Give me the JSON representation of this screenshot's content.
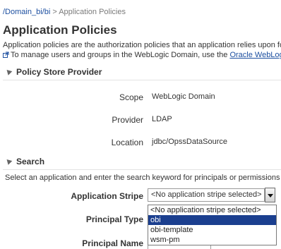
{
  "breadcrumb": {
    "link": "/Domain_bi/bi",
    "separator": ">",
    "current": "Application Policies"
  },
  "page": {
    "title": "Application Policies",
    "description": "Application policies are the authorization policies that an application relies upon for",
    "manage_text": "To manage users and groups in the WebLogic Domain, use the",
    "manage_link": "Oracle WebLogi",
    "manage_icon": "external-link-icon"
  },
  "policy_store": {
    "header": "Policy Store Provider",
    "scope_label": "Scope",
    "scope_value": "WebLogic Domain",
    "provider_label": "Provider",
    "provider_value": "LDAP",
    "location_label": "Location",
    "location_value": "jdbc/OpssDataSource"
  },
  "search": {
    "header": "Search",
    "description": "Select an application and enter the search keyword for principals or permissions",
    "stripe_label": "Application Stripe",
    "stripe_selected": "<No application stripe selected>",
    "stripe_options": [
      "<No application stripe selected>",
      "obi",
      "obi-template",
      "wsm-pm"
    ],
    "highlighted_option": "obi",
    "principal_type_label": "Principal Type",
    "principal_name_label": "Principal Name"
  },
  "colors": {
    "link": "#1c4fa0",
    "selection": "#1b3f8f"
  }
}
